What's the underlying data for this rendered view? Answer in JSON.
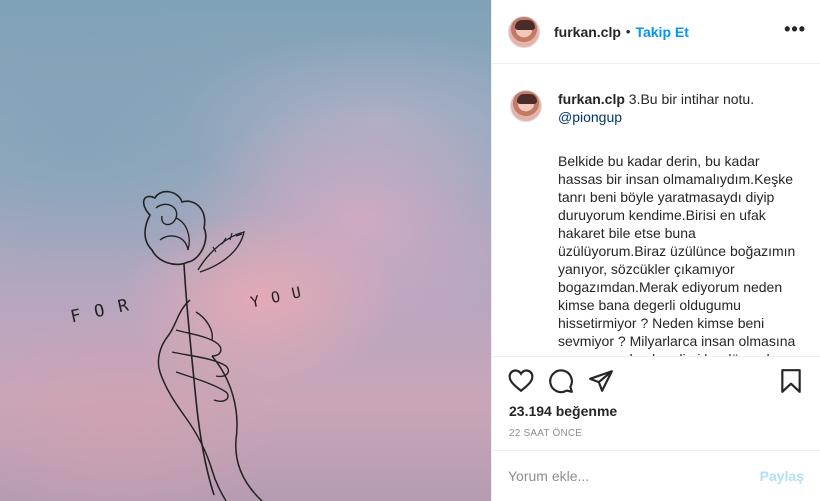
{
  "post": {
    "username": "furkan.clp",
    "follow_label": "Takip Et",
    "separator": "•",
    "more_label": "•••",
    "image_text": {
      "left": "FOR",
      "right": "YOU"
    }
  },
  "caption": {
    "username": "furkan.clp",
    "title": "3.Bu bir intihar notu.",
    "mention": "@piongup",
    "body": "Belkide bu kadar derin, bu kadar hassas bir insan olmamalıydım.Keşke tanrı beni böyle yaratmasaydı diyip duruyorum kendime.Birisi en ufak hakaret bile etse buna üzülüyorum.Biraz üzülünce boğazımın yanıyor, sözcükler çıkamıyor bogazımdan.Merak ediyorum neden kimse bana degerli oldugumu hissetirmiyor ? Neden kimse beni sevmiyor ? Milyarlarca insan olmasına ragmen neden kendimi bu dünyada yalnız ve degersiz hissediyorum ? Biraz daha selanceli, daha yalnızlık, daha"
  },
  "icons": {
    "like": "heart-icon",
    "comment": "comment-icon",
    "share": "share-icon",
    "save": "bookmark-icon"
  },
  "stats": {
    "likes": "23.194 beğenme",
    "timestamp": "22 SAAT ÖNCE"
  },
  "comment": {
    "placeholder": "Yorum ekle...",
    "post_label": "Paylaş"
  },
  "colors": {
    "accent": "#0095f6",
    "post_disabled": "#b2dffc",
    "muted": "#8e8e8e"
  }
}
